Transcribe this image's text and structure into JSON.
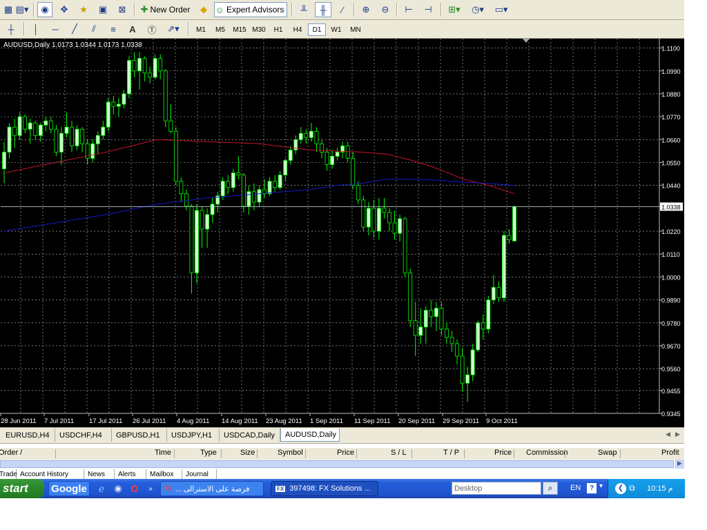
{
  "toolbar": {
    "new_order_label": "New Order",
    "expert_advisors_label": "Expert Advisors",
    "timeframes": [
      "M1",
      "M5",
      "M15",
      "M30",
      "H1",
      "H4",
      "D1",
      "W1",
      "MN"
    ],
    "active_timeframe": "D1"
  },
  "chart": {
    "header": "AUDUSD,Daily  1.0173 1.0344 1.0173 1.0338",
    "current_price_label": "1.0338"
  },
  "chart_data": {
    "type": "candlestick",
    "symbol": "AUDUSD",
    "timeframe": "Daily",
    "ohlc_last": {
      "open": 1.0173,
      "high": 1.0344,
      "low": 1.0173,
      "close": 1.0338
    },
    "y_ticks": [
      "1.1100",
      "1.0990",
      "1.0880",
      "1.0770",
      "1.0660",
      "1.0550",
      "1.0440",
      "1.0338",
      "1.0220",
      "1.0110",
      "1.0000",
      "0.9890",
      "0.9780",
      "0.9670",
      "0.9560",
      "0.9455",
      "0.9345"
    ],
    "x_ticks": [
      "28 Jun 2011",
      "7 Jul 2011",
      "17 Jul 2011",
      "26 Jul 2011",
      "4 Aug 2011",
      "14 Aug 2011",
      "23 Aug 2011",
      "1 Sep 2011",
      "11 Sep 2011",
      "20 Sep 2011",
      "29 Sep 2011",
      "9 Oct 2011"
    ],
    "ylim": [
      0.9345,
      1.1145
    ],
    "current_price": 1.0338,
    "candles": [
      {
        "o": 1.052,
        "h": 1.065,
        "l": 1.045,
        "c": 1.06
      },
      {
        "o": 1.06,
        "h": 1.074,
        "l": 1.057,
        "c": 1.072
      },
      {
        "o": 1.072,
        "h": 1.076,
        "l": 1.062,
        "c": 1.068
      },
      {
        "o": 1.068,
        "h": 1.079,
        "l": 1.066,
        "c": 1.077
      },
      {
        "o": 1.077,
        "h": 1.078,
        "l": 1.069,
        "c": 1.071
      },
      {
        "o": 1.071,
        "h": 1.076,
        "l": 1.064,
        "c": 1.074
      },
      {
        "o": 1.074,
        "h": 1.075,
        "l": 1.066,
        "c": 1.068
      },
      {
        "o": 1.068,
        "h": 1.074,
        "l": 1.065,
        "c": 1.073
      },
      {
        "o": 1.073,
        "h": 1.077,
        "l": 1.07,
        "c": 1.075
      },
      {
        "o": 1.075,
        "h": 1.077,
        "l": 1.069,
        "c": 1.071
      },
      {
        "o": 1.071,
        "h": 1.073,
        "l": 1.058,
        "c": 1.06
      },
      {
        "o": 1.06,
        "h": 1.072,
        "l": 1.054,
        "c": 1.069
      },
      {
        "o": 1.069,
        "h": 1.079,
        "l": 1.067,
        "c": 1.072
      },
      {
        "o": 1.072,
        "h": 1.075,
        "l": 1.06,
        "c": 1.063
      },
      {
        "o": 1.063,
        "h": 1.073,
        "l": 1.061,
        "c": 1.071
      },
      {
        "o": 1.071,
        "h": 1.072,
        "l": 1.06,
        "c": 1.064
      },
      {
        "o": 1.064,
        "h": 1.066,
        "l": 1.054,
        "c": 1.057
      },
      {
        "o": 1.057,
        "h": 1.066,
        "l": 1.055,
        "c": 1.064
      },
      {
        "o": 1.064,
        "h": 1.07,
        "l": 1.059,
        "c": 1.068
      },
      {
        "o": 1.068,
        "h": 1.075,
        "l": 1.066,
        "c": 1.072
      },
      {
        "o": 1.072,
        "h": 1.086,
        "l": 1.07,
        "c": 1.084
      },
      {
        "o": 1.084,
        "h": 1.087,
        "l": 1.078,
        "c": 1.082
      },
      {
        "o": 1.082,
        "h": 1.086,
        "l": 1.077,
        "c": 1.083
      },
      {
        "o": 1.083,
        "h": 1.09,
        "l": 1.081,
        "c": 1.088
      },
      {
        "o": 1.088,
        "h": 1.106,
        "l": 1.086,
        "c": 1.104
      },
      {
        "o": 1.104,
        "h": 1.108,
        "l": 1.096,
        "c": 1.099
      },
      {
        "o": 1.099,
        "h": 1.108,
        "l": 1.09,
        "c": 1.105
      },
      {
        "o": 1.105,
        "h": 1.106,
        "l": 1.094,
        "c": 1.098
      },
      {
        "o": 1.098,
        "h": 1.101,
        "l": 1.093,
        "c": 1.096
      },
      {
        "o": 1.096,
        "h": 1.107,
        "l": 1.095,
        "c": 1.105
      },
      {
        "o": 1.105,
        "h": 1.107,
        "l": 1.095,
        "c": 1.099
      },
      {
        "o": 1.099,
        "h": 1.1,
        "l": 1.072,
        "c": 1.075
      },
      {
        "o": 1.075,
        "h": 1.083,
        "l": 1.069,
        "c": 1.07
      },
      {
        "o": 1.07,
        "h": 1.072,
        "l": 1.044,
        "c": 1.046
      },
      {
        "o": 1.046,
        "h": 1.048,
        "l": 1.036,
        "c": 1.04
      },
      {
        "o": 1.04,
        "h": 1.042,
        "l": 1.032,
        "c": 1.034
      },
      {
        "o": 1.034,
        "h": 1.035,
        "l": 0.992,
        "c": 1.002
      },
      {
        "o": 1.002,
        "h": 1.035,
        "l": 0.997,
        "c": 1.032
      },
      {
        "o": 1.032,
        "h": 1.034,
        "l": 1.014,
        "c": 1.023
      },
      {
        "o": 1.023,
        "h": 1.033,
        "l": 1.014,
        "c": 1.03
      },
      {
        "o": 1.03,
        "h": 1.038,
        "l": 1.026,
        "c": 1.035
      },
      {
        "o": 1.035,
        "h": 1.041,
        "l": 1.031,
        "c": 1.039
      },
      {
        "o": 1.039,
        "h": 1.048,
        "l": 1.037,
        "c": 1.046
      },
      {
        "o": 1.046,
        "h": 1.049,
        "l": 1.04,
        "c": 1.043
      },
      {
        "o": 1.043,
        "h": 1.052,
        "l": 1.041,
        "c": 1.05
      },
      {
        "o": 1.05,
        "h": 1.058,
        "l": 1.047,
        "c": 1.049
      },
      {
        "o": 1.049,
        "h": 1.05,
        "l": 1.031,
        "c": 1.034
      },
      {
        "o": 1.034,
        "h": 1.044,
        "l": 1.03,
        "c": 1.041
      },
      {
        "o": 1.041,
        "h": 1.045,
        "l": 1.032,
        "c": 1.036
      },
      {
        "o": 1.036,
        "h": 1.044,
        "l": 1.034,
        "c": 1.042
      },
      {
        "o": 1.042,
        "h": 1.047,
        "l": 1.038,
        "c": 1.04
      },
      {
        "o": 1.04,
        "h": 1.048,
        "l": 1.039,
        "c": 1.046
      },
      {
        "o": 1.046,
        "h": 1.049,
        "l": 1.041,
        "c": 1.043
      },
      {
        "o": 1.043,
        "h": 1.051,
        "l": 1.042,
        "c": 1.049
      },
      {
        "o": 1.049,
        "h": 1.057,
        "l": 1.046,
        "c": 1.056
      },
      {
        "o": 1.056,
        "h": 1.063,
        "l": 1.054,
        "c": 1.061
      },
      {
        "o": 1.061,
        "h": 1.068,
        "l": 1.059,
        "c": 1.066
      },
      {
        "o": 1.066,
        "h": 1.072,
        "l": 1.064,
        "c": 1.069
      },
      {
        "o": 1.069,
        "h": 1.071,
        "l": 1.064,
        "c": 1.067
      },
      {
        "o": 1.067,
        "h": 1.074,
        "l": 1.065,
        "c": 1.07
      },
      {
        "o": 1.07,
        "h": 1.072,
        "l": 1.06,
        "c": 1.064
      },
      {
        "o": 1.064,
        "h": 1.066,
        "l": 1.057,
        "c": 1.06
      },
      {
        "o": 1.06,
        "h": 1.062,
        "l": 1.051,
        "c": 1.054
      },
      {
        "o": 1.054,
        "h": 1.061,
        "l": 1.052,
        "c": 1.058
      },
      {
        "o": 1.058,
        "h": 1.062,
        "l": 1.056,
        "c": 1.06
      },
      {
        "o": 1.06,
        "h": 1.065,
        "l": 1.057,
        "c": 1.063
      },
      {
        "o": 1.063,
        "h": 1.065,
        "l": 1.055,
        "c": 1.057
      },
      {
        "o": 1.057,
        "h": 1.06,
        "l": 1.042,
        "c": 1.044
      },
      {
        "o": 1.044,
        "h": 1.046,
        "l": 1.035,
        "c": 1.037
      },
      {
        "o": 1.037,
        "h": 1.039,
        "l": 1.022,
        "c": 1.024
      },
      {
        "o": 1.024,
        "h": 1.036,
        "l": 1.02,
        "c": 1.033
      },
      {
        "o": 1.033,
        "h": 1.037,
        "l": 1.019,
        "c": 1.022
      },
      {
        "o": 1.022,
        "h": 1.038,
        "l": 1.018,
        "c": 1.033
      },
      {
        "o": 1.033,
        "h": 1.038,
        "l": 1.028,
        "c": 1.031
      },
      {
        "o": 1.031,
        "h": 1.033,
        "l": 1.022,
        "c": 1.026
      },
      {
        "o": 1.026,
        "h": 1.032,
        "l": 1.018,
        "c": 1.021
      },
      {
        "o": 1.021,
        "h": 1.03,
        "l": 1.017,
        "c": 1.028
      },
      {
        "o": 1.028,
        "h": 1.029,
        "l": 1.0,
        "c": 1.002
      },
      {
        "o": 1.002,
        "h": 1.004,
        "l": 0.976,
        "c": 0.979
      },
      {
        "o": 0.979,
        "h": 0.988,
        "l": 0.962,
        "c": 0.972
      },
      {
        "o": 0.972,
        "h": 0.985,
        "l": 0.968,
        "c": 0.976
      },
      {
        "o": 0.976,
        "h": 0.986,
        "l": 0.968,
        "c": 0.984
      },
      {
        "o": 0.984,
        "h": 0.989,
        "l": 0.976,
        "c": 0.981
      },
      {
        "o": 0.981,
        "h": 0.988,
        "l": 0.974,
        "c": 0.985
      },
      {
        "o": 0.985,
        "h": 0.988,
        "l": 0.972,
        "c": 0.975
      },
      {
        "o": 0.975,
        "h": 0.978,
        "l": 0.968,
        "c": 0.971
      },
      {
        "o": 0.971,
        "h": 0.974,
        "l": 0.964,
        "c": 0.968
      },
      {
        "o": 0.968,
        "h": 0.97,
        "l": 0.958,
        "c": 0.962
      },
      {
        "o": 0.962,
        "h": 0.966,
        "l": 0.945,
        "c": 0.949
      },
      {
        "o": 0.949,
        "h": 0.957,
        "l": 0.94,
        "c": 0.953
      },
      {
        "o": 0.953,
        "h": 0.968,
        "l": 0.95,
        "c": 0.965
      },
      {
        "o": 0.965,
        "h": 0.979,
        "l": 0.964,
        "c": 0.978
      },
      {
        "o": 0.978,
        "h": 0.982,
        "l": 0.97,
        "c": 0.975
      },
      {
        "o": 0.975,
        "h": 0.991,
        "l": 0.973,
        "c": 0.989
      },
      {
        "o": 0.989,
        "h": 1.001,
        "l": 0.987,
        "c": 0.995
      },
      {
        "o": 0.995,
        "h": 0.998,
        "l": 0.988,
        "c": 0.99
      },
      {
        "o": 0.99,
        "h": 1.022,
        "l": 0.988,
        "c": 1.02
      },
      {
        "o": 1.02,
        "h": 1.023,
        "l": 1.016,
        "c": 1.018
      },
      {
        "o": 1.0173,
        "h": 1.0344,
        "l": 1.0173,
        "c": 1.0338
      }
    ],
    "ma_red": [
      [
        0,
        1.05
      ],
      [
        10,
        1.055
      ],
      [
        20,
        1.06
      ],
      [
        30,
        1.066
      ],
      [
        40,
        1.065
      ],
      [
        50,
        1.064
      ],
      [
        60,
        1.061
      ],
      [
        70,
        1.06
      ],
      [
        75,
        1.059
      ],
      [
        80,
        1.056
      ],
      [
        85,
        1.052
      ],
      [
        90,
        1.047
      ],
      [
        95,
        1.044
      ],
      [
        100,
        1.04
      ]
    ],
    "ma_blue": [
      [
        0,
        1.022
      ],
      [
        10,
        1.026
      ],
      [
        20,
        1.03
      ],
      [
        30,
        1.035
      ],
      [
        40,
        1.038
      ],
      [
        50,
        1.04
      ],
      [
        60,
        1.042
      ],
      [
        65,
        1.044
      ],
      [
        70,
        1.045
      ],
      [
        75,
        1.047
      ],
      [
        80,
        1.047
      ],
      [
        85,
        1.0465
      ],
      [
        90,
        1.0455
      ],
      [
        95,
        1.045
      ],
      [
        100,
        1.044
      ]
    ]
  },
  "chart_tabs": [
    "EURUSD,H4",
    "USDCHF,H4",
    "GBPUSD,H1",
    "USDJPY,H1",
    "USDCAD,Daily",
    "AUDUSD,Daily"
  ],
  "active_chart_tab": "AUDUSD,Daily",
  "terminal": {
    "columns": [
      "Order  /",
      "Time",
      "Type",
      "Size",
      "Symbol",
      "Price",
      "S / L",
      "T / P",
      "Price",
      "Commission",
      "Swap",
      "Profit"
    ],
    "tabs": [
      "Trade",
      "Account History",
      "News",
      "Alerts",
      "Mailbox",
      "Journal"
    ]
  },
  "taskbar": {
    "start_label": "start",
    "google_label": "Google",
    "task1_label": "... فرصة على الاسترالى",
    "task2_label": "397498: FX Solutions ...",
    "desktop_field": "Desktop",
    "lang": "EN",
    "clock": "10:15 م"
  },
  "colors": {
    "chart_bg": "#000000",
    "grid": "#c0c0c0",
    "bull_body": "#ccffcc",
    "bear_body": "#000000",
    "candle_stroke": "#00ff00",
    "ma_red": "#c4162a",
    "ma_blue": "#1818c8"
  }
}
